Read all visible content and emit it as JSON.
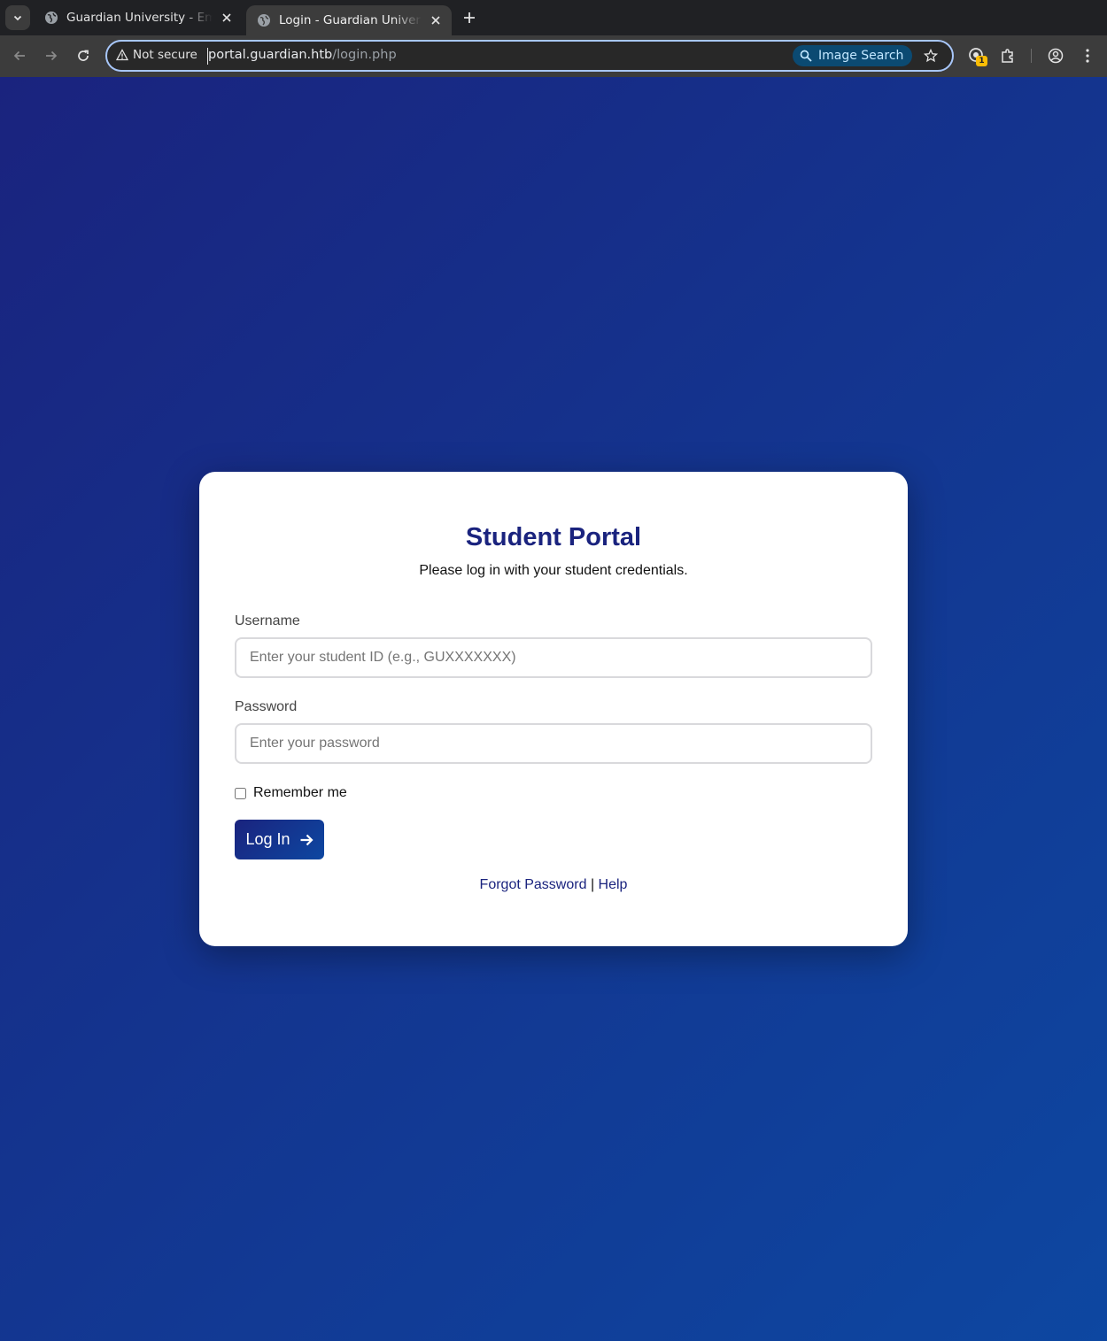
{
  "browser": {
    "tabs": [
      {
        "title": "Guardian University - Employee Portal",
        "active": false
      },
      {
        "title": "Login - Guardian University",
        "active": true
      }
    ],
    "security_label": "Not secure",
    "url_host": "portal.guardian.htb",
    "url_path": "/login.php",
    "image_search_label": "Image Search",
    "extension_badge": "1"
  },
  "login": {
    "title": "Student Portal",
    "subtitle": "Please log in with your student credentials.",
    "username_label": "Username",
    "username_placeholder": "Enter your student ID (e.g., GUXXXXXXX)",
    "password_label": "Password",
    "password_placeholder": "Enter your password",
    "remember_label": "Remember me",
    "submit_label": "Log In",
    "forgot_link": "Forgot Password",
    "separator": "|",
    "help_link": "Help"
  },
  "colors": {
    "brand_primary": "#1a237e",
    "brand_secondary": "#0d47a1"
  }
}
